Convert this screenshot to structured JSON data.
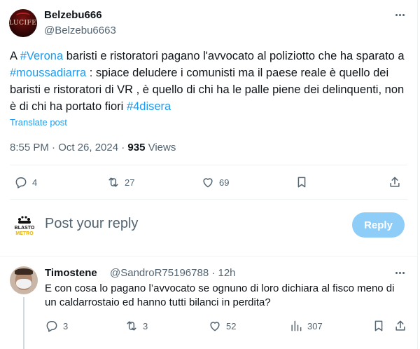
{
  "tweet": {
    "display_name": "Belzebu666",
    "handle": "@Belzebu6663",
    "avatar_text": "LUCIFER",
    "text_parts": {
      "p1": "A ",
      "tag1": "#Verona",
      "p2": " baristi e ristoratori pagano l'avvocato al poliziotto che ha sparato a  ",
      "tag2": "#moussadiarra",
      "p3": "  : spiace deludere i comunisti ma il paese reale è quello dei baristi e ristoratori di VR , è quello di chi ha le palle piene dei delinquenti, non è di chi ha portato fiori ",
      "tag3": "#4disera"
    },
    "translate": "Translate post",
    "timestamp": "8:55 PM · Oct 26, 2024 · ",
    "views_count": "935",
    "views_label": " Views",
    "actions": {
      "replies": "4",
      "reposts": "27",
      "likes": "69"
    }
  },
  "composer": {
    "avatar_text_top": "BLASTO",
    "avatar_text_bottom": "METRO",
    "placeholder": "Post your reply",
    "button": "Reply"
  },
  "reply": {
    "display_name": "Timostene",
    "handle": "@SandroR75196788 · 12h",
    "text": "E con cosa lo pagano l’avvocato se ognuno di loro dichiara al fisco meno di un caldarrostaio ed hanno tutti bilanci in perdita?",
    "actions": {
      "replies": "3",
      "reposts": "3",
      "likes": "52",
      "views": "307"
    }
  },
  "colors": {
    "accent": "#1d9bf0",
    "secondary_text": "#536471",
    "reply_button": "#8ecdf8"
  },
  "icons": [
    "more-icon",
    "reply-icon",
    "repost-icon",
    "like-icon",
    "bookmark-icon",
    "share-icon",
    "views-icon"
  ]
}
